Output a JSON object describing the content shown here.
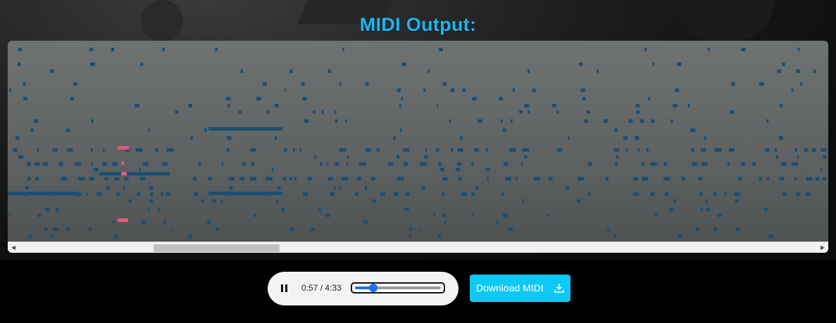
{
  "header": {
    "title": "MIDI Output:"
  },
  "piano_roll": {
    "note_color": "#1b4e72",
    "highlight_color": "#e65a78",
    "scroll_position": 0.2
  },
  "player": {
    "state": "playing",
    "time_display": "0:57 / 4:33",
    "progress": 0.21,
    "accent_color": "#1a73e8"
  },
  "download": {
    "label": "Download MIDI",
    "icon": "download-icon",
    "color": "#10c8f6"
  },
  "colors": {
    "title": "#1ab6ef",
    "background": "#000000"
  }
}
